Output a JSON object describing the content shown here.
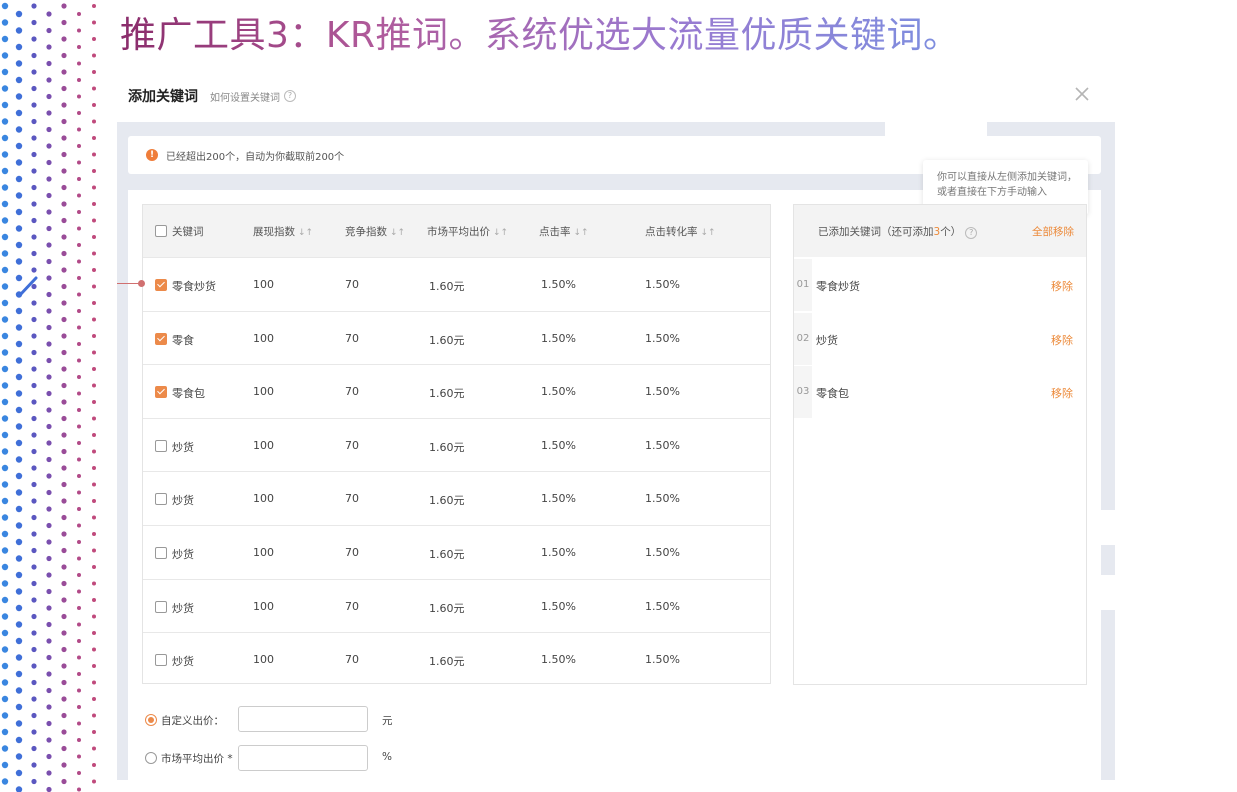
{
  "slide": {
    "title": "推广工具3：KR推词。系统优选大流量优质关键词。"
  },
  "dialog": {
    "title": "添加关键词",
    "help_link": "如何设置关键词",
    "alert": "已经超出200个，自动为你截取前200个",
    "tooltip_line1": "你可以直接从左侧添加关键词，",
    "tooltip_line2": "或者直接在下方手动输入"
  },
  "table": {
    "headers": [
      "关键词",
      "展现指数",
      "竞争指数",
      "市场平均出价",
      "点击率",
      "点击转化率"
    ],
    "sort_icon": "↓↑",
    "rows": [
      {
        "keyword": "零食炒货",
        "impressions": "100",
        "competition": "70",
        "avg_bid": "1.60元",
        "ctr": "1.50%",
        "cvr": "1.50%",
        "checked": true
      },
      {
        "keyword": "零食",
        "impressions": "100",
        "competition": "70",
        "avg_bid": "1.60元",
        "ctr": "1.50%",
        "cvr": "1.50%",
        "checked": true
      },
      {
        "keyword": "零食包",
        "impressions": "100",
        "competition": "70",
        "avg_bid": "1.60元",
        "ctr": "1.50%",
        "cvr": "1.50%",
        "checked": true
      },
      {
        "keyword": "炒货",
        "impressions": "100",
        "competition": "70",
        "avg_bid": "1.60元",
        "ctr": "1.50%",
        "cvr": "1.50%",
        "checked": false
      },
      {
        "keyword": "炒货",
        "impressions": "100",
        "competition": "70",
        "avg_bid": "1.60元",
        "ctr": "1.50%",
        "cvr": "1.50%",
        "checked": false
      },
      {
        "keyword": "炒货",
        "impressions": "100",
        "competition": "70",
        "avg_bid": "1.60元",
        "ctr": "1.50%",
        "cvr": "1.50%",
        "checked": false
      },
      {
        "keyword": "炒货",
        "impressions": "100",
        "competition": "70",
        "avg_bid": "1.60元",
        "ctr": "1.50%",
        "cvr": "1.50%",
        "checked": false
      },
      {
        "keyword": "炒货",
        "impressions": "100",
        "competition": "70",
        "avg_bid": "1.60元",
        "ctr": "1.50%",
        "cvr": "1.50%",
        "checked": false
      }
    ]
  },
  "added": {
    "header_prefix": "已添加关键词（还可添加",
    "remaining": "3",
    "header_suffix": "个）",
    "remove_all": "全部移除",
    "items": [
      {
        "index": "01",
        "keyword": "零食炒货",
        "remove": "移除"
      },
      {
        "index": "02",
        "keyword": "炒货",
        "remove": "移除"
      },
      {
        "index": "03",
        "keyword": "零食包",
        "remove": "移除"
      }
    ]
  },
  "bid": {
    "custom_label": "自定义出价：",
    "custom_unit": "元",
    "custom_value": "",
    "market_label": "市场平均出价 *",
    "market_unit": "%",
    "market_value": "",
    "selected": "custom"
  },
  "colors": {
    "accent": "#ec8a4a",
    "panel_bg": "#e6e9f0",
    "title_start": "#8a2c6b",
    "title_end": "#7c8fe0"
  }
}
